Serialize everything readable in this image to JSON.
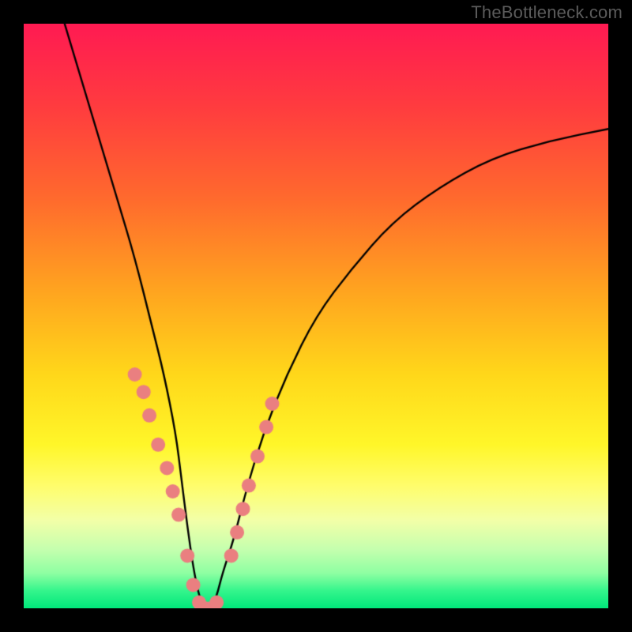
{
  "watermark": "TheBottleneck.com",
  "chart_data": {
    "type": "line",
    "title": "",
    "xlabel": "",
    "ylabel": "",
    "xlim": [
      0,
      100
    ],
    "ylim": [
      0,
      100
    ],
    "background_gradient": {
      "top_color": "#ff1a52",
      "bottom_color": "#00e77a",
      "direction": "vertical"
    },
    "series": [
      {
        "name": "v-curve",
        "stroke": "#000000",
        "x": [
          7,
          10,
          13,
          16,
          19,
          22,
          24,
          26,
          27,
          28,
          29,
          30,
          31,
          32,
          33,
          34,
          36,
          38,
          41,
          45,
          50,
          56,
          63,
          71,
          80,
          90,
          100
        ],
        "values": [
          100,
          90,
          80,
          70,
          60,
          48,
          40,
          30,
          22,
          14,
          7,
          2,
          0,
          0,
          2,
          6,
          12,
          20,
          30,
          40,
          50,
          58,
          66,
          72,
          77,
          80,
          82
        ]
      }
    ],
    "markers": {
      "name": "sample-dots",
      "fill": "#ea7f80",
      "radius": 9,
      "x": [
        19,
        20.5,
        21.5,
        23,
        24.5,
        25.5,
        26.5,
        28,
        29,
        30,
        31,
        32,
        33,
        35.5,
        36.5,
        37.5,
        38.5,
        40,
        41.5,
        42.5
      ],
      "values": [
        40,
        37,
        33,
        28,
        24,
        20,
        16,
        9,
        4,
        1,
        0,
        0,
        1,
        9,
        13,
        17,
        21,
        26,
        31,
        35
      ]
    }
  }
}
